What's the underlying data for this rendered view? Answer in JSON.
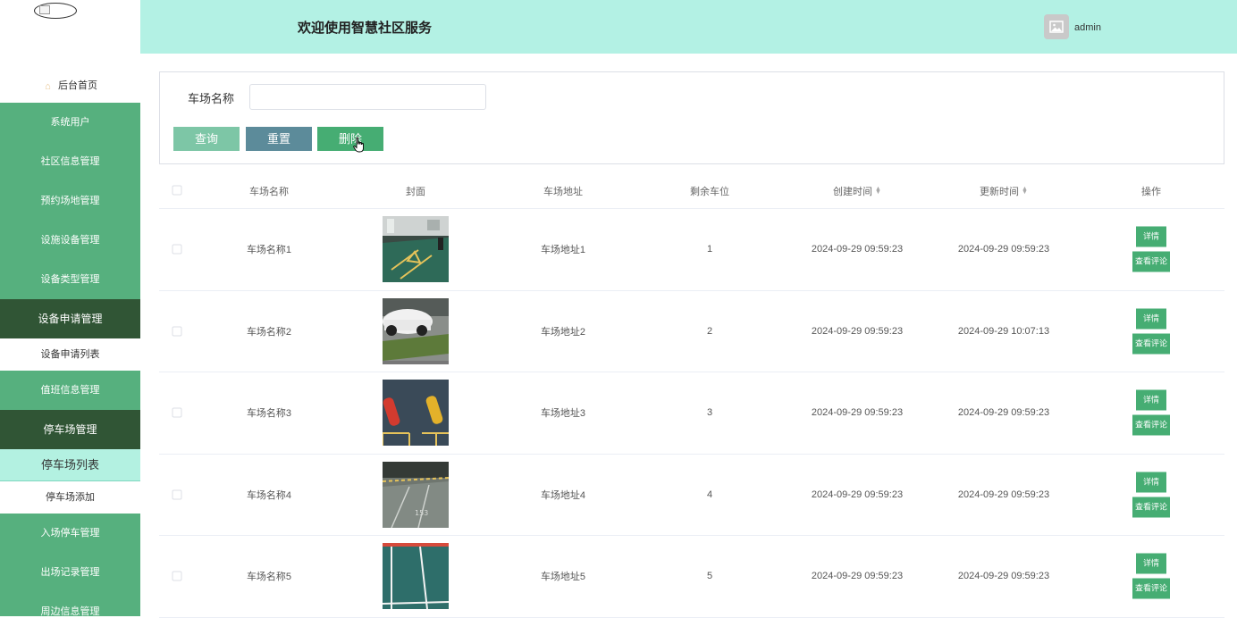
{
  "header": {
    "title": "欢迎使用智慧社区服务",
    "username": "admin"
  },
  "sidebar": {
    "home": "后台首页",
    "items": [
      {
        "label": "系统用户",
        "style": "normal"
      },
      {
        "label": "社区信息管理",
        "style": "normal"
      },
      {
        "label": "预约场地管理",
        "style": "normal"
      },
      {
        "label": "设施设备管理",
        "style": "normal"
      },
      {
        "label": "设备类型管理",
        "style": "normal"
      },
      {
        "label": "设备申请管理",
        "style": "dark"
      },
      {
        "label": "设备申请列表",
        "style": "sub"
      },
      {
        "label": "值班信息管理",
        "style": "normal"
      },
      {
        "label": "停车场管理",
        "style": "dark"
      },
      {
        "label": "停车场列表",
        "style": "sub-active"
      },
      {
        "label": "停车场添加",
        "style": "sub"
      },
      {
        "label": "入场停车管理",
        "style": "normal"
      },
      {
        "label": "出场记录管理",
        "style": "normal"
      },
      {
        "label": "周边信息管理",
        "style": "normal"
      }
    ]
  },
  "search": {
    "field_label": "车场名称",
    "field_value": "",
    "query_label": "查询",
    "reset_label": "重置",
    "delete_label": "删除"
  },
  "table": {
    "headers": {
      "name": "车场名称",
      "cover": "封面",
      "address": "车场地址",
      "spaces": "剩余车位",
      "created": "创建时间",
      "updated": "更新时间",
      "ops": "操作"
    },
    "detail_label": "详情",
    "review_label": "查看评论",
    "rows": [
      {
        "name": "车场名称1",
        "cover": "parking-garage-photo",
        "address": "车场地址1",
        "spaces": "1",
        "created": "2024-09-29 09:59:23",
        "updated": "2024-09-29 09:59:23"
      },
      {
        "name": "车场名称2",
        "cover": "parked-white-car-photo",
        "address": "车场地址2",
        "spaces": "2",
        "created": "2024-09-29 09:59:23",
        "updated": "2024-09-29 10:07:13"
      },
      {
        "name": "车场名称3",
        "cover": "aerial-cars-photo",
        "address": "车场地址3",
        "spaces": "3",
        "created": "2024-09-29 09:59:23",
        "updated": "2024-09-29 09:59:23"
      },
      {
        "name": "车场名称4",
        "cover": "underground-lot-photo",
        "address": "车场地址4",
        "spaces": "4",
        "created": "2024-09-29 09:59:23",
        "updated": "2024-09-29 09:59:23"
      },
      {
        "name": "车场名称5",
        "cover": "green-lot-lines-photo",
        "address": "车场地址5",
        "spaces": "5",
        "created": "2024-09-29 09:59:23",
        "updated": "2024-09-29 09:59:23"
      }
    ]
  },
  "colors": {
    "accent": "#56b07e",
    "dark": "#305535",
    "header_bg": "#b3f1e4",
    "button_green": "#46ad73"
  }
}
